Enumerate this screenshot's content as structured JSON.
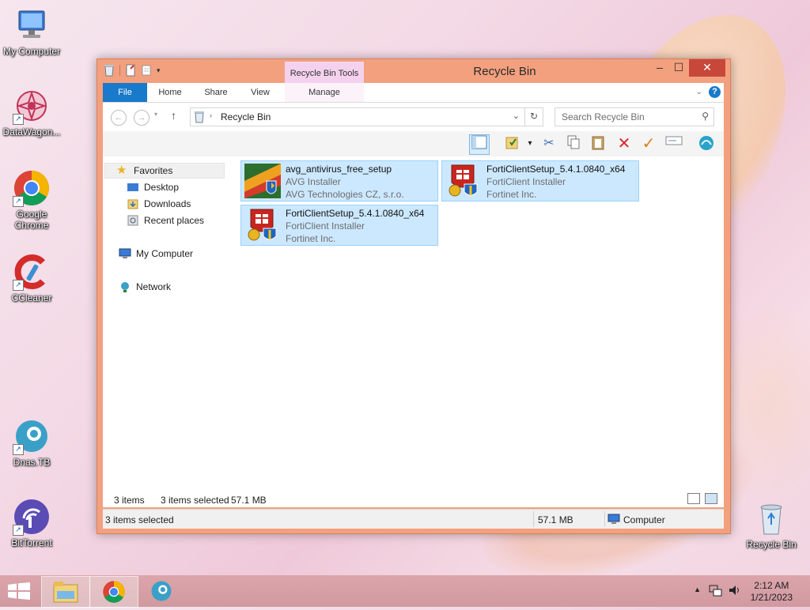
{
  "desktop": {
    "icons": [
      {
        "label": "My Computer"
      },
      {
        "label": "DataWagon..."
      },
      {
        "label": "Google Chrome"
      },
      {
        "label": "CCleaner"
      },
      {
        "label": "Dnas.TB"
      },
      {
        "label": "BitTorrent"
      },
      {
        "label": "Recycle Bin"
      }
    ]
  },
  "window": {
    "title": "Recycle Bin",
    "context_tab_group": "Recycle Bin Tools",
    "ribbon_tabs": {
      "file": "File",
      "home": "Home",
      "share": "Share",
      "view": "View",
      "manage": "Manage"
    },
    "address": {
      "path": "Recycle Bin"
    },
    "search": {
      "placeholder": "Search Recycle Bin"
    },
    "nav": {
      "favorites": "Favorites",
      "desktop": "Desktop",
      "downloads": "Downloads",
      "recent": "Recent places",
      "computer": "My Computer",
      "network": "Network"
    },
    "files": [
      {
        "name": "avg_antivirus_free_setup",
        "type": "AVG Installer",
        "company": "AVG Technologies CZ, s.r.o.",
        "icon": "avg-installer-icon"
      },
      {
        "name": "FortiClientSetup_5.4.1.0840_x64",
        "type": "FortiClient Installer",
        "company": "Fortinet Inc.",
        "icon": "forticlient-installer-icon"
      },
      {
        "name": "FortiClientSetup_5.4.1.0840_x64",
        "type": "FortiClient Installer",
        "company": "Fortinet Inc.",
        "icon": "forticlient-installer-icon"
      }
    ],
    "status": {
      "count": "3 items",
      "selected": "3 items selected",
      "size": "57.1 MB"
    },
    "details_bar": {
      "selected": "3 items selected",
      "size": "57.1 MB",
      "location": "Computer"
    }
  },
  "taskbar": {
    "clock_time": "2:12 AM",
    "clock_date": "1/21/2023"
  },
  "colors": {
    "window_frame": "#f3a07e",
    "file_tab": "#1979ca",
    "close_button": "#c7473a",
    "selection": "#cce8ff",
    "context_tab": "#f4d2ee"
  }
}
